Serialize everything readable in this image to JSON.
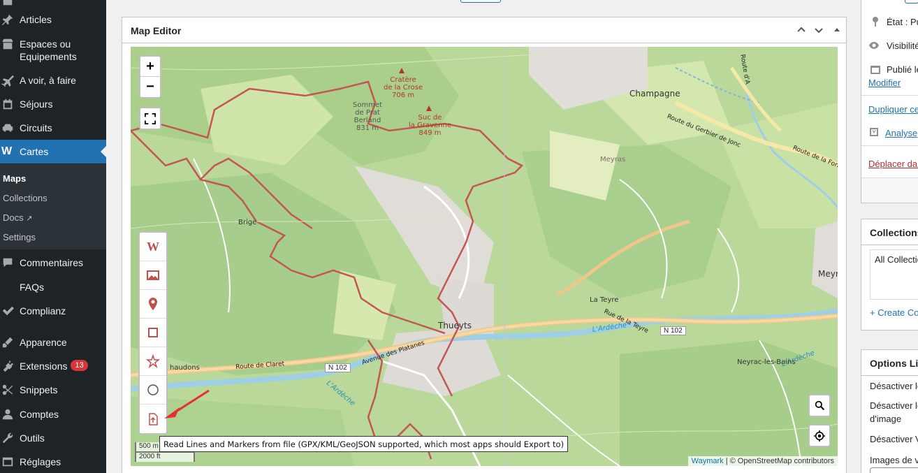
{
  "sidebar": {
    "items": [
      {
        "label": "Articles",
        "icon": "pin-icon"
      },
      {
        "label": "Espaces ou Equipements",
        "icon": "store-icon"
      },
      {
        "label": "A voir, à faire",
        "icon": "plane-icon"
      },
      {
        "label": "Séjours",
        "icon": "calendar-icon"
      },
      {
        "label": "Circuits",
        "icon": "car-icon"
      },
      {
        "label": "Cartes",
        "icon": "waymark-icon"
      },
      {
        "label": "Commentaires",
        "icon": "comment-icon"
      },
      {
        "label": "FAQs",
        "icon": ""
      },
      {
        "label": "Complianz",
        "icon": "check-icon"
      },
      {
        "label": "Apparence",
        "icon": "brush-icon"
      },
      {
        "label": "Extensions",
        "icon": "plugin-icon",
        "badge": "13"
      },
      {
        "label": "Snippets",
        "icon": "snippet-icon"
      },
      {
        "label": "Comptes",
        "icon": "user-icon"
      },
      {
        "label": "Outils",
        "icon": "wrench-icon"
      },
      {
        "label": "Réglages",
        "icon": "settings-icon"
      }
    ],
    "submenu": [
      {
        "label": "Maps"
      },
      {
        "label": "Collections"
      },
      {
        "label": "Docs"
      },
      {
        "label": "Settings"
      }
    ]
  },
  "panel": {
    "title": "Map Editor"
  },
  "map": {
    "zoom_in": "+",
    "zoom_out": "−",
    "labels": {
      "crater": "Cratère\nde la Crose\n706 m",
      "sommet": "Sommet\nde Prat\nBerland\n831 m",
      "suc": "Suc de\nla Gravenne\n849 m",
      "champagne": "Champagne",
      "route_gerbier": "Route du Gerbier de Jonc",
      "route_fonts": "Route de la Font",
      "route_arda": "Route d'A",
      "meyras": "Meyras",
      "brige": "Brige",
      "la_teyre": "La Teyre",
      "rue_teyre": "Rue de la Teyre",
      "thueyts": "Thueyts",
      "ardeche1": "L'Ardèche",
      "ardeche2": "L'Ardèche",
      "ardeche3": "L'Ardèche",
      "avenue": "Avenue des Platanes",
      "route_claret": "Route de Claret",
      "chaudons": "haudons",
      "neyrac": "Neyrac-les-Bains",
      "meyr": "Meyr",
      "n102_a": "N 102",
      "n102_b": "N 102"
    },
    "scale_m": "500 m",
    "scale_ft": "2000 ft",
    "attribution_link": "Waymark",
    "attribution_text": "| © OpenStreetMap contributors",
    "tooltip": "Read Lines and Markers from file (GPX/KML/GeoJSON supported, which most apps should Export to)"
  },
  "right": {
    "etat": "État : Pu",
    "visibilite": "Visibilité",
    "publie": "Publié le",
    "modifier": "Modifier",
    "dupliquer": "Dupliquer ce",
    "analyse": "Analyse",
    "deplacer": "Déplacer dan",
    "collections_title": "Collections",
    "all_collections": "All Collectio",
    "create_collection": "+ Create Co",
    "options_title": "Options Lit",
    "opt1": "Désactiver le",
    "opt2": "Désactiver le",
    "opt2b": "d'image",
    "opt3": "Désactiver V",
    "opt4": "Images de v"
  },
  "colors": {
    "accent": "#2271b1",
    "sidebar_bg": "#1d2327",
    "badge": "#d63638",
    "route": "#c0504d"
  }
}
